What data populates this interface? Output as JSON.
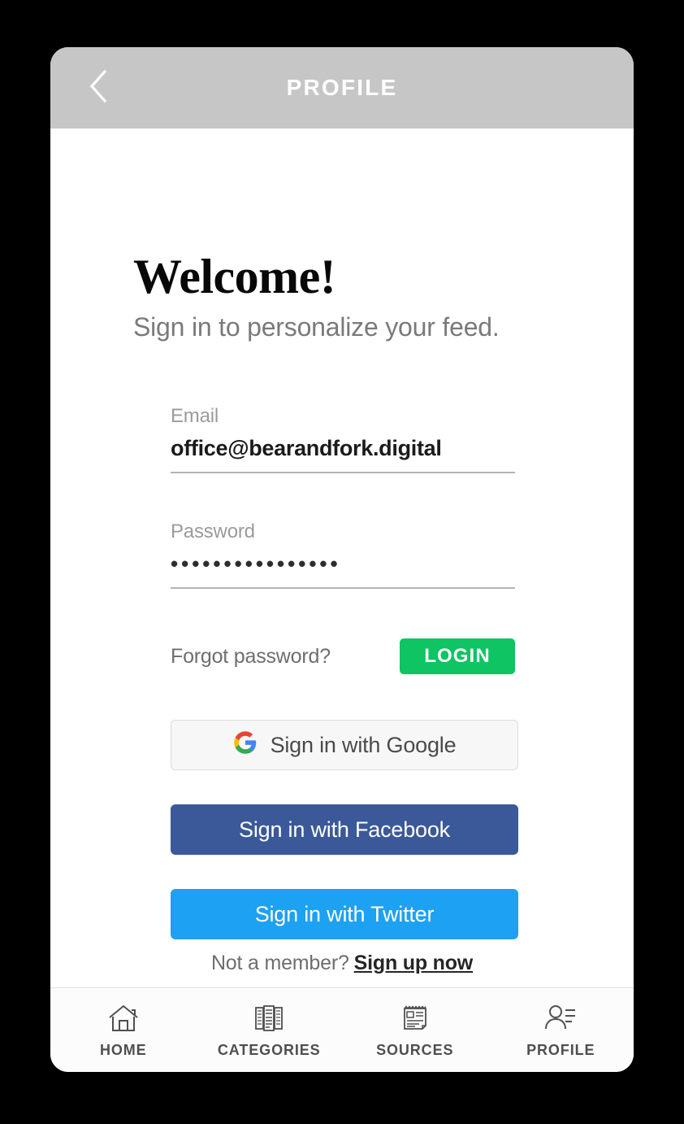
{
  "app_bar": {
    "title": "PROFILE",
    "back_icon": "chevron-left-icon",
    "background_color": "#c6c6c6",
    "title_color": "#ffffff"
  },
  "welcome": {
    "heading": "Welcome!",
    "subtitle": "Sign in to personalize your feed."
  },
  "form": {
    "email": {
      "label": "Email",
      "value": "office@bearandfork.digital",
      "placeholder": "Email"
    },
    "password": {
      "label": "Password",
      "value": "••••••••••••••••",
      "placeholder": "Password",
      "masked": true,
      "character_count": 16
    },
    "forgot_password_label": "Forgot password?",
    "login_label": "LOGIN",
    "login_color": "#0ec463"
  },
  "social": {
    "google": {
      "label": "Sign in with Google",
      "icon": "google-g-icon",
      "background_color": "#f7f7f7",
      "text_color": "#4a4a4a"
    },
    "facebook": {
      "label": "Sign in with Facebook",
      "background_color": "#3b5998",
      "text_color": "#ffffff"
    },
    "twitter": {
      "label": "Sign in with Twitter",
      "background_color": "#1da1f2",
      "text_color": "#ffffff"
    }
  },
  "signup": {
    "prompt": "Not a member?",
    "link_label": "Sign up now"
  },
  "bottom_nav": {
    "items": [
      {
        "label": "HOME",
        "icon": "home-icon",
        "active": false
      },
      {
        "label": "CATEGORIES",
        "icon": "documents-stack-icon",
        "active": false
      },
      {
        "label": "SOURCES",
        "icon": "newspaper-icon",
        "active": false
      },
      {
        "label": "PROFILE",
        "icon": "person-lines-icon",
        "active": true
      }
    ]
  }
}
